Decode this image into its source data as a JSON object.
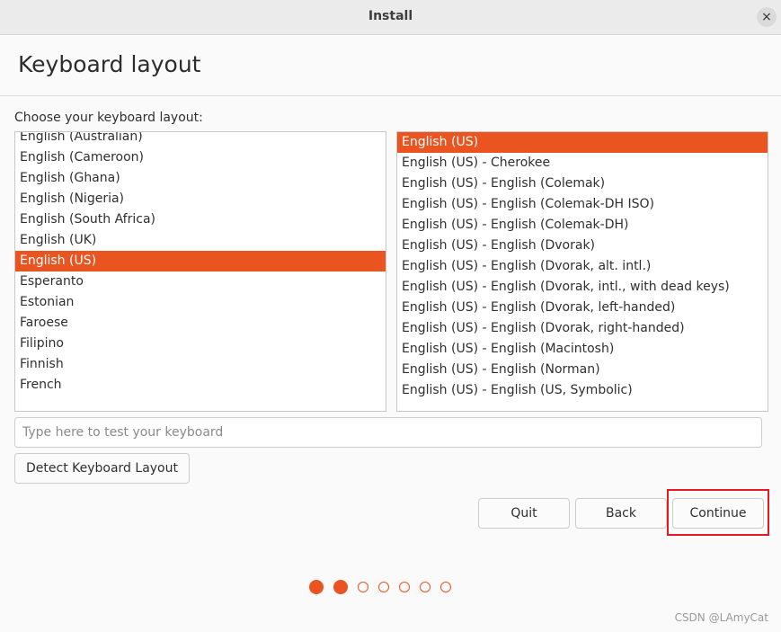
{
  "window": {
    "title": "Install",
    "close_icon": "×"
  },
  "page": {
    "title": "Keyboard layout",
    "list_label": "Choose your keyboard layout:"
  },
  "layouts": {
    "items": [
      {
        "label": "English (Australian)",
        "selected": false
      },
      {
        "label": "English (Cameroon)",
        "selected": false
      },
      {
        "label": "English (Ghana)",
        "selected": false
      },
      {
        "label": "English (Nigeria)",
        "selected": false
      },
      {
        "label": "English (South Africa)",
        "selected": false
      },
      {
        "label": "English (UK)",
        "selected": false
      },
      {
        "label": "English (US)",
        "selected": true
      },
      {
        "label": "Esperanto",
        "selected": false
      },
      {
        "label": "Estonian",
        "selected": false
      },
      {
        "label": "Faroese",
        "selected": false
      },
      {
        "label": "Filipino",
        "selected": false
      },
      {
        "label": "Finnish",
        "selected": false
      },
      {
        "label": "French",
        "selected": false
      }
    ]
  },
  "variants": {
    "items": [
      {
        "label": "English (US)",
        "selected": true
      },
      {
        "label": "English (US) - Cherokee",
        "selected": false
      },
      {
        "label": "English (US) - English (Colemak)",
        "selected": false
      },
      {
        "label": "English (US) - English (Colemak-DH ISO)",
        "selected": false
      },
      {
        "label": "English (US) - English (Colemak-DH)",
        "selected": false
      },
      {
        "label": "English (US) - English (Dvorak)",
        "selected": false
      },
      {
        "label": "English (US) - English (Dvorak, alt. intl.)",
        "selected": false
      },
      {
        "label": "English (US) - English (Dvorak, intl., with dead keys)",
        "selected": false
      },
      {
        "label": "English (US) - English (Dvorak, left-handed)",
        "selected": false
      },
      {
        "label": "English (US) - English (Dvorak, right-handed)",
        "selected": false
      },
      {
        "label": "English (US) - English (Macintosh)",
        "selected": false
      },
      {
        "label": "English (US) - English (Norman)",
        "selected": false
      },
      {
        "label": "English (US) - English (US, Symbolic)",
        "selected": false
      }
    ]
  },
  "test_input": {
    "placeholder": "Type here to test your keyboard",
    "value": ""
  },
  "buttons": {
    "detect": "Detect Keyboard Layout",
    "quit": "Quit",
    "back": "Back",
    "continue": "Continue"
  },
  "progress": {
    "current_step": 2,
    "total_steps": 7
  },
  "watermark": "CSDN @LAmyCat",
  "colors": {
    "accent": "#e95420",
    "highlight_border": "#e01b24"
  }
}
